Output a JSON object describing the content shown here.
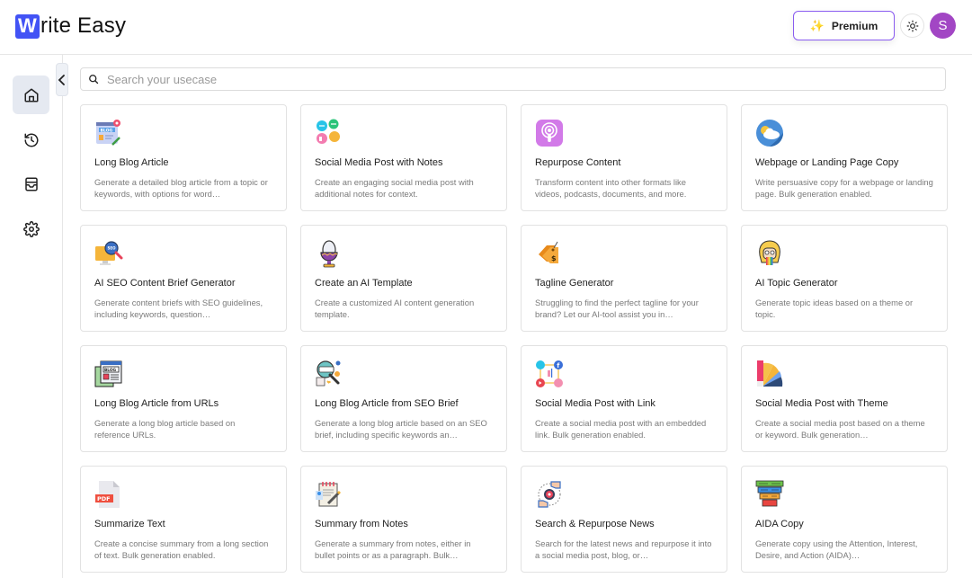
{
  "header": {
    "logo_letter": "W",
    "logo_rest": "rite Easy",
    "premium_label": "Premium",
    "premium_icon": "sparkles-icon",
    "theme_icon": "sun-icon",
    "avatar_initial": "S"
  },
  "colors": {
    "brand": "#4253f5",
    "premium_border": "#8a5cf0",
    "avatar": "#a246c4",
    "sidebar_active": "#e5e9f1"
  },
  "sidebar": {
    "items": [
      {
        "name": "home",
        "icon": "home-icon",
        "active": true
      },
      {
        "name": "history",
        "icon": "history-icon",
        "active": false
      },
      {
        "name": "inbox",
        "icon": "inbox-icon",
        "active": false
      },
      {
        "name": "settings",
        "icon": "gear-icon",
        "active": false
      }
    ],
    "collapse_icon": "chevron-left-icon"
  },
  "search": {
    "placeholder": "Search your usecase",
    "value": ""
  },
  "cards": [
    {
      "title": "Long Blog Article",
      "desc": "Generate a detailed blog article from a topic or keywords, with options for word…",
      "icon": "blog-icon"
    },
    {
      "title": "Social Media Post with Notes",
      "desc": "Create an engaging social media post with additional notes for context.",
      "icon": "social-bubbles-icon"
    },
    {
      "title": "Repurpose Content",
      "desc": "Transform content into other formats like videos, podcasts, documents, and more.",
      "icon": "podcast-icon"
    },
    {
      "title": "Webpage or Landing Page Copy",
      "desc": "Write persuasive copy for a webpage or landing page. Bulk generation enabled.",
      "icon": "weather-cloud-icon"
    },
    {
      "title": "AI SEO Content Brief Generator",
      "desc": "Generate content briefs with SEO guidelines, including keywords, question…",
      "icon": "seo-monitor-icon"
    },
    {
      "title": "Create an AI Template",
      "desc": "Create a customized AI content generation template.",
      "icon": "egg-cup-icon"
    },
    {
      "title": "Tagline Generator",
      "desc": "Struggling to find the perfect tagline for your brand? Let our AI-tool assist you in…",
      "icon": "price-tag-icon"
    },
    {
      "title": "AI Topic Generator",
      "desc": "Generate topic ideas based on a theme or topic.",
      "icon": "rainbow-girl-icon"
    },
    {
      "title": "Long Blog Article from URLs",
      "desc": "Generate a long blog article based on reference URLs.",
      "icon": "blog-window-icon"
    },
    {
      "title": "Long Blog Article from SEO Brief",
      "desc": "Generate a long blog article based on an SEO brief, including specific keywords an…",
      "icon": "seo-search-icon"
    },
    {
      "title": "Social Media Post with Link",
      "desc": "Create a social media post with an embedded link. Bulk generation enabled.",
      "icon": "social-network-icon"
    },
    {
      "title": "Social Media Post with Theme",
      "desc": "Create a social media post based on a theme or keyword. Bulk generation…",
      "icon": "color-palette-icon"
    },
    {
      "title": "Summarize Text",
      "desc": "Create a concise summary from a long section of text. Bulk generation enabled.",
      "icon": "pdf-file-icon"
    },
    {
      "title": "Summary from Notes",
      "desc": "Generate a summary from notes, either in bullet points or as a paragraph. Bulk…",
      "icon": "notepad-icon"
    },
    {
      "title": "Search & Repurpose News",
      "desc": "Search for the latest news and repurpose it into a social media post, blog, or…",
      "icon": "target-hands-icon"
    },
    {
      "title": "AIDA Copy",
      "desc": "Generate copy using the Attention, Interest, Desire, and Action (AIDA)…",
      "icon": "funnel-icon"
    }
  ]
}
